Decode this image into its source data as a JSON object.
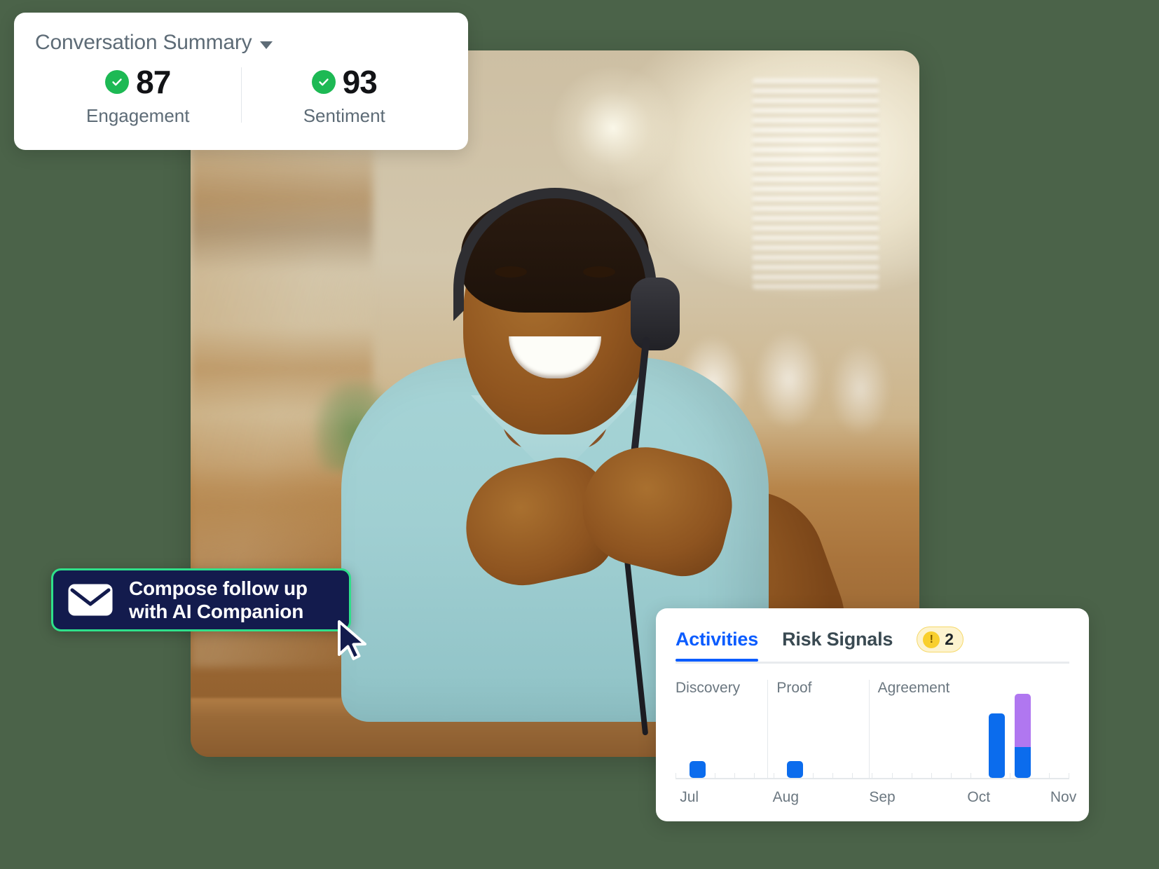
{
  "background_color": "#4b6349",
  "summary_card": {
    "title": "Conversation Summary",
    "caret_icon": "chevron-down-icon",
    "metrics": [
      {
        "value": "87",
        "label": "Engagement",
        "status_icon": "check-circle-icon",
        "status_color": "#1db954"
      },
      {
        "value": "93",
        "label": "Sentiment",
        "status_icon": "check-circle-icon",
        "status_color": "#1db954"
      }
    ]
  },
  "compose_button": {
    "icon": "envelope-icon",
    "label": "Compose follow up\nwith AI Companion",
    "background_color": "#131b4d",
    "border_color": "#2fe08a",
    "text_color": "#ffffff"
  },
  "cursor": {
    "icon": "mouse-pointer-icon",
    "color": "#131b4d"
  },
  "activities_card": {
    "tabs": [
      {
        "label": "Activities",
        "active": true
      },
      {
        "label": "Risk Signals",
        "active": false
      }
    ],
    "risk_badge": {
      "icon": "warning-icon",
      "count": "2",
      "background_color": "#fdf3cf",
      "accent_color": "#f9cf2d"
    },
    "accent_color": "#0b5cff"
  },
  "chart_data": {
    "type": "bar",
    "title": "Activities",
    "xlabel": "",
    "ylabel": "",
    "grid": false,
    "legend_position": "none",
    "phases": [
      {
        "name": "Discovery",
        "start_fraction": 0.0,
        "end_fraction": 0.245
      },
      {
        "name": "Proof",
        "start_fraction": 0.245,
        "end_fraction": 0.49
      },
      {
        "name": "Agreement",
        "start_fraction": 0.49,
        "end_fraction": 1.0
      }
    ],
    "x_tick_labels": [
      "Jul",
      "Aug",
      "Sep",
      "Oct",
      "Nov"
    ],
    "x_tick_positions": [
      0.035,
      0.28,
      0.525,
      0.77,
      0.985
    ],
    "series": [
      {
        "name": "Activities",
        "color": "#0b6ced"
      },
      {
        "name": "Agreement",
        "color": "#b077f0"
      }
    ],
    "bars": [
      {
        "x_fraction": 0.035,
        "segments": [
          {
            "series": "Activities",
            "value": 12
          }
        ]
      },
      {
        "x_fraction": 0.283,
        "segments": [
          {
            "series": "Activities",
            "value": 12
          }
        ]
      },
      {
        "x_fraction": 0.795,
        "segments": [
          {
            "series": "Activities",
            "value": 46
          }
        ]
      },
      {
        "x_fraction": 0.862,
        "segments": [
          {
            "series": "Activities",
            "value": 22
          },
          {
            "series": "Agreement",
            "value": 38
          }
        ]
      }
    ],
    "ylim": [
      0,
      60
    ]
  }
}
